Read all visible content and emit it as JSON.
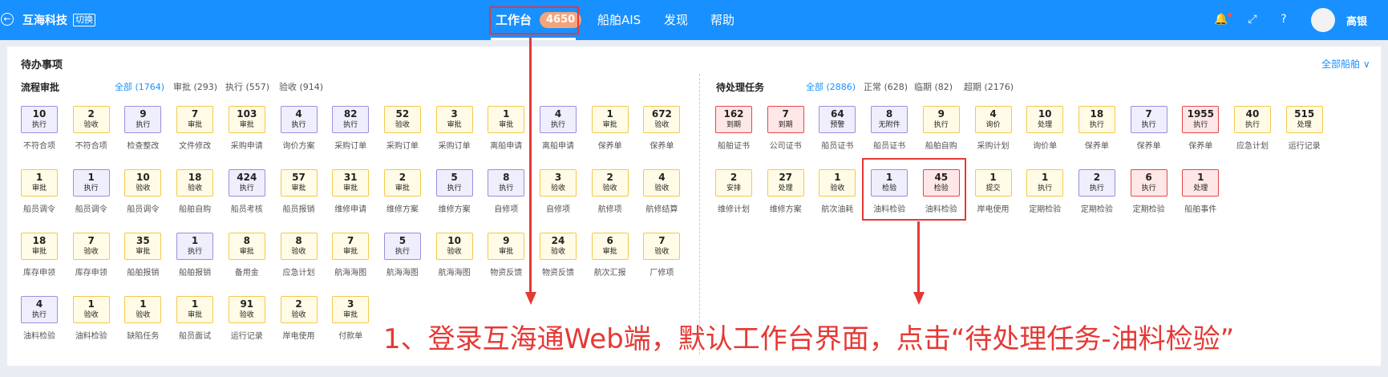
{
  "header": {
    "brand": "互海科技",
    "switch": "切换",
    "nav": [
      {
        "label": "工作台",
        "count": "4650"
      },
      {
        "label": "船舶AIS"
      },
      {
        "label": "发现"
      },
      {
        "label": "帮助"
      }
    ],
    "user": "高银"
  },
  "main": {
    "title": "待办事项",
    "all_ships": "全部船舶 ∨",
    "left": {
      "title": "流程审批",
      "filters": [
        "全部 (1764)",
        "审批 (293)",
        "执行 (557)",
        "验收 (914)"
      ],
      "tiles": [
        {
          "n": "10",
          "t": "执行",
          "l": "不符合项",
          "c": "b"
        },
        {
          "n": "2",
          "t": "验收",
          "l": "不符合项",
          "c": "y"
        },
        {
          "n": "9",
          "t": "执行",
          "l": "检查整改",
          "c": "b"
        },
        {
          "n": "7",
          "t": "审批",
          "l": "文件修改",
          "c": "y"
        },
        {
          "n": "103",
          "t": "审批",
          "l": "采购申请",
          "c": "y"
        },
        {
          "n": "4",
          "t": "执行",
          "l": "询价方案",
          "c": "b"
        },
        {
          "n": "82",
          "t": "执行",
          "l": "采购订单",
          "c": "b"
        },
        {
          "n": "52",
          "t": "验收",
          "l": "采购订单",
          "c": "y"
        },
        {
          "n": "3",
          "t": "审批",
          "l": "采购订单",
          "c": "y"
        },
        {
          "n": "1",
          "t": "审批",
          "l": "离船申请",
          "c": "y"
        },
        {
          "n": "4",
          "t": "执行",
          "l": "离船申请",
          "c": "b"
        },
        {
          "n": "1",
          "t": "审批",
          "l": "保养单",
          "c": "y"
        },
        {
          "n": "672",
          "t": "验收",
          "l": "保养单",
          "c": "y"
        },
        {
          "n": "1",
          "t": "审批",
          "l": "船员调令",
          "c": "y"
        },
        {
          "n": "1",
          "t": "执行",
          "l": "船员调令",
          "c": "b"
        },
        {
          "n": "10",
          "t": "验收",
          "l": "船员调令",
          "c": "y"
        },
        {
          "n": "18",
          "t": "验收",
          "l": "船舶自购",
          "c": "y"
        },
        {
          "n": "424",
          "t": "执行",
          "l": "船员考核",
          "c": "b"
        },
        {
          "n": "57",
          "t": "审批",
          "l": "船员报销",
          "c": "y"
        },
        {
          "n": "31",
          "t": "审批",
          "l": "维修申请",
          "c": "y"
        },
        {
          "n": "2",
          "t": "审批",
          "l": "维修方案",
          "c": "y"
        },
        {
          "n": "5",
          "t": "执行",
          "l": "维修方案",
          "c": "b"
        },
        {
          "n": "8",
          "t": "执行",
          "l": "自修项",
          "c": "b"
        },
        {
          "n": "3",
          "t": "验收",
          "l": "自修项",
          "c": "y"
        },
        {
          "n": "2",
          "t": "验收",
          "l": "航修项",
          "c": "y"
        },
        {
          "n": "4",
          "t": "验收",
          "l": "航修结算",
          "c": "y"
        },
        {
          "n": "18",
          "t": "审批",
          "l": "库存申领",
          "c": "y"
        },
        {
          "n": "7",
          "t": "验收",
          "l": "库存申领",
          "c": "y"
        },
        {
          "n": "35",
          "t": "审批",
          "l": "船舶报销",
          "c": "y"
        },
        {
          "n": "1",
          "t": "执行",
          "l": "船舶报销",
          "c": "b"
        },
        {
          "n": "8",
          "t": "审批",
          "l": "备用金",
          "c": "y"
        },
        {
          "n": "8",
          "t": "验收",
          "l": "应急计划",
          "c": "y"
        },
        {
          "n": "7",
          "t": "审批",
          "l": "航海海图",
          "c": "y"
        },
        {
          "n": "5",
          "t": "执行",
          "l": "航海海图",
          "c": "b"
        },
        {
          "n": "10",
          "t": "验收",
          "l": "航海海图",
          "c": "y"
        },
        {
          "n": "9",
          "t": "审批",
          "l": "物资反馈",
          "c": "y"
        },
        {
          "n": "24",
          "t": "验收",
          "l": "物资反馈",
          "c": "y"
        },
        {
          "n": "6",
          "t": "审批",
          "l": "航次汇报",
          "c": "y"
        },
        {
          "n": "7",
          "t": "验收",
          "l": "厂修项",
          "c": "y"
        },
        {
          "n": "4",
          "t": "执行",
          "l": "油料检验",
          "c": "b"
        },
        {
          "n": "1",
          "t": "验收",
          "l": "油料检验",
          "c": "y"
        },
        {
          "n": "1",
          "t": "验收",
          "l": "缺陷任务",
          "c": "y"
        },
        {
          "n": "1",
          "t": "审批",
          "l": "船员面试",
          "c": "y"
        },
        {
          "n": "91",
          "t": "验收",
          "l": "运行记录",
          "c": "y"
        },
        {
          "n": "2",
          "t": "验收",
          "l": "岸电使用",
          "c": "y"
        },
        {
          "n": "3",
          "t": "审批",
          "l": "付款单",
          "c": "y"
        }
      ]
    },
    "right": {
      "title": "待处理任务",
      "filters": [
        "全部 (2886)",
        "正常 (628)",
        "临期 (82)",
        "超期 (2176)"
      ],
      "tiles": [
        {
          "n": "162",
          "t": "到期",
          "l": "船舶证书",
          "c": "r"
        },
        {
          "n": "7",
          "t": "到期",
          "l": "公司证书",
          "c": "r"
        },
        {
          "n": "64",
          "t": "预警",
          "l": "船员证书",
          "c": "b"
        },
        {
          "n": "8",
          "t": "无附件",
          "l": "船员证书",
          "c": "b"
        },
        {
          "n": "9",
          "t": "执行",
          "l": "船舶自购",
          "c": "y"
        },
        {
          "n": "4",
          "t": "询价",
          "l": "采购计划",
          "c": "y"
        },
        {
          "n": "10",
          "t": "处理",
          "l": "询价单",
          "c": "y"
        },
        {
          "n": "18",
          "t": "执行",
          "l": "保养单",
          "c": "y"
        },
        {
          "n": "7",
          "t": "执行",
          "l": "保养单",
          "c": "b"
        },
        {
          "n": "1955",
          "t": "执行",
          "l": "保养单",
          "c": "r"
        },
        {
          "n": "40",
          "t": "执行",
          "l": "应急计划",
          "c": "y"
        },
        {
          "n": "515",
          "t": "处理",
          "l": "运行记录",
          "c": "y"
        },
        {
          "n": "2",
          "t": "安排",
          "l": "维修计划",
          "c": "y"
        },
        {
          "n": "27",
          "t": "处理",
          "l": "维修方案",
          "c": "y"
        },
        {
          "n": "1",
          "t": "验收",
          "l": "航次油耗",
          "c": "y"
        },
        {
          "n": "1",
          "t": "检验",
          "l": "油料检验",
          "c": "b"
        },
        {
          "n": "45",
          "t": "检验",
          "l": "油料检验",
          "c": "r"
        },
        {
          "n": "1",
          "t": "提交",
          "l": "岸电使用",
          "c": "y"
        },
        {
          "n": "1",
          "t": "执行",
          "l": "定期检验",
          "c": "y"
        },
        {
          "n": "2",
          "t": "执行",
          "l": "定期检验",
          "c": "b"
        },
        {
          "n": "6",
          "t": "执行",
          "l": "定期检验",
          "c": "r"
        },
        {
          "n": "1",
          "t": "处理",
          "l": "船舶事件",
          "c": "r"
        }
      ]
    }
  },
  "annotation": "1、登录互海通Web端，默认工作台界面，点击“待处理任务-油料检验”"
}
